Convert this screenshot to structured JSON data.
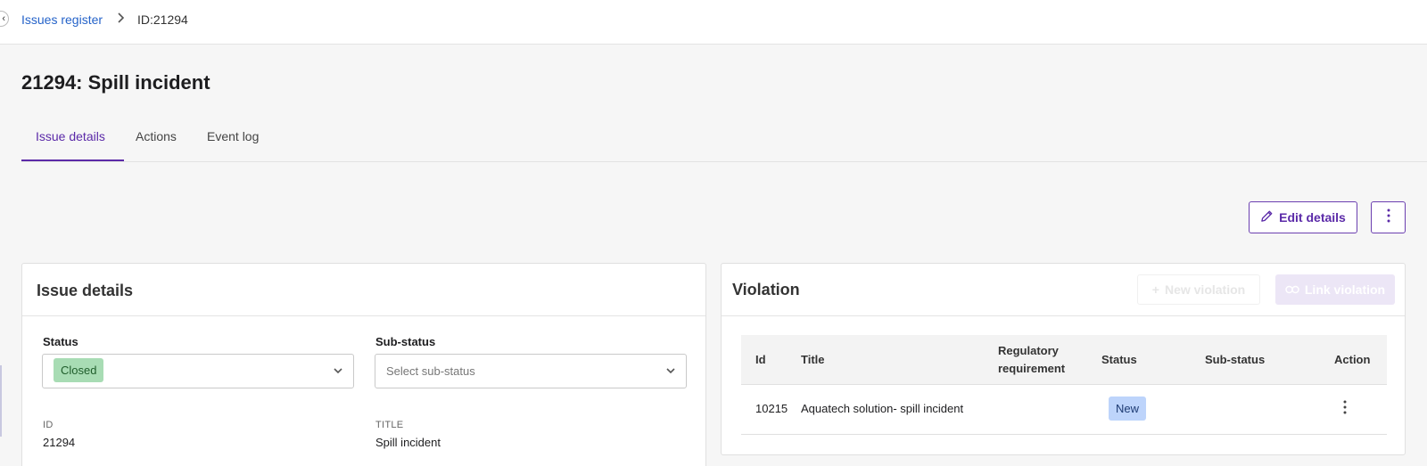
{
  "breadcrumb": {
    "parent": "Issues register",
    "current": "ID:21294"
  },
  "page": {
    "title": "21294: Spill incident"
  },
  "tabs": [
    {
      "label": "Issue details",
      "active": true
    },
    {
      "label": "Actions",
      "active": false
    },
    {
      "label": "Event log",
      "active": false
    }
  ],
  "toolbar": {
    "edit_label": "Edit details",
    "more_icon": "more-vertical-icon"
  },
  "issue_panel": {
    "title": "Issue details",
    "status_label": "Status",
    "status_value": "Closed",
    "substatus_label": "Sub-status",
    "substatus_placeholder": "Select sub-status",
    "id_label": "ID",
    "id_value": "21294",
    "title_label": "TITLE",
    "title_value": "Spill incident"
  },
  "violation_panel": {
    "title": "Violation",
    "new_label": "New violation",
    "link_label": "Link violation",
    "columns": [
      "Id",
      "Title",
      "Regulatory requirement",
      "Status",
      "Sub-status",
      "Action"
    ],
    "rows": [
      {
        "id": "10215",
        "title": "Aquatech solution- spill incident",
        "requirement": "",
        "status": "New",
        "substatus": ""
      }
    ]
  },
  "colors": {
    "accent": "#5b2aa8",
    "link": "#2563c9",
    "closed_chip": "#a8dcb4",
    "new_badge": "#bdd4fb"
  }
}
